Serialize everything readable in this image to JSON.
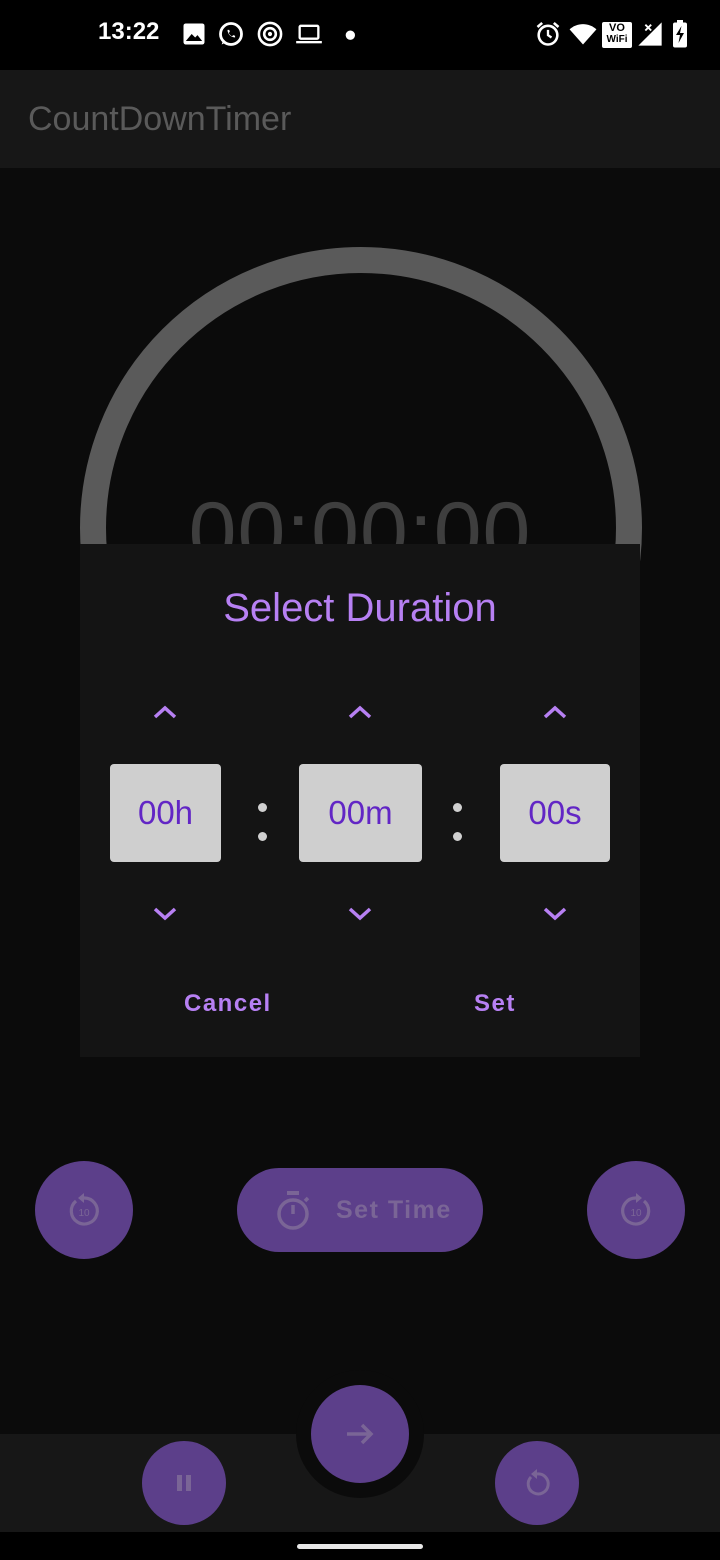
{
  "status_bar": {
    "time": "13:22",
    "left_icons": [
      "image-icon",
      "whatsapp-icon",
      "circle-target-icon",
      "laptop-icon",
      "dot-icon"
    ],
    "right_icons": [
      "alarm-icon",
      "wifi-icon",
      "vowifi-icon",
      "signal-icon",
      "battery-charging-icon"
    ],
    "vowifi_text": [
      "VO",
      "WiFi"
    ]
  },
  "app_bar": {
    "title": "CountDownTimer"
  },
  "timer": {
    "display": "00:00:00"
  },
  "dialog": {
    "title": "Select Duration",
    "hours": "00h",
    "minutes": "00m",
    "seconds": "00s",
    "cancel_label": "Cancel",
    "set_label": "Set"
  },
  "actions": {
    "set_time_label": "Set Time",
    "rewind_label": "10",
    "forward_label": "10"
  },
  "colors": {
    "accent": "#b780f3",
    "value_text": "#6226c5",
    "button_fill": "#5c3f8a",
    "dialog_bg": "#141414",
    "ring": "#5a5a5a"
  }
}
